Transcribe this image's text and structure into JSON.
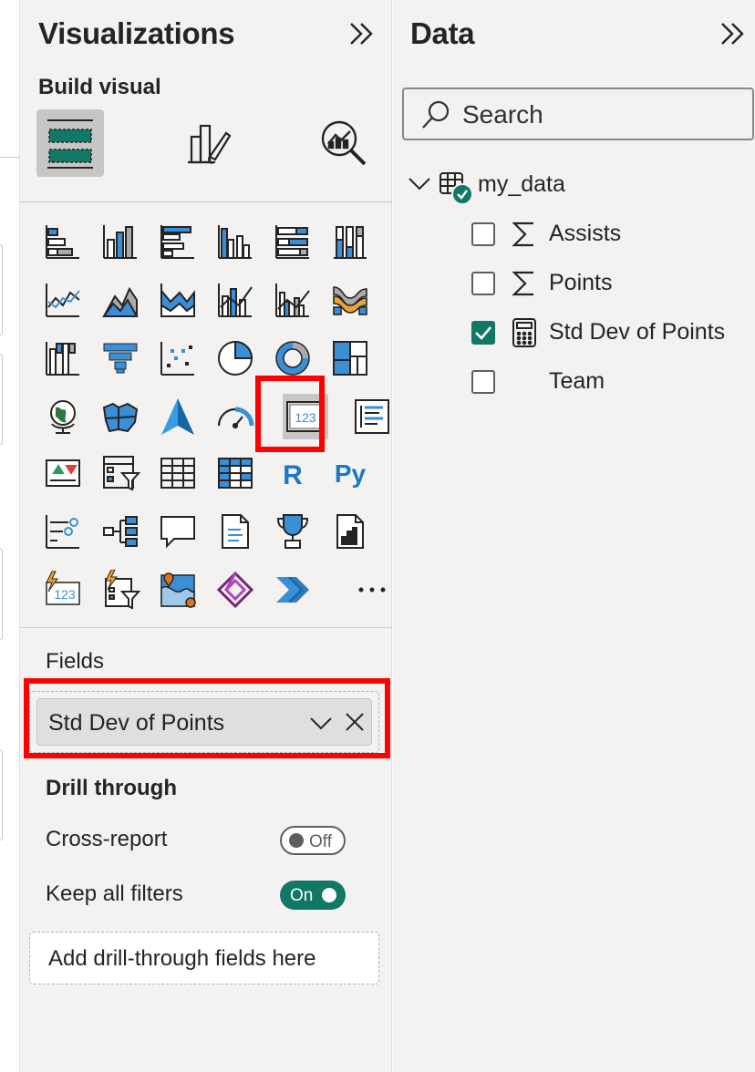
{
  "visualizations": {
    "title": "Visualizations",
    "build_visual_label": "Build visual",
    "tabs": [
      {
        "name": "build-visual-tab",
        "active": true
      },
      {
        "name": "format-visual-tab",
        "active": false
      },
      {
        "name": "analytics-tab",
        "active": false
      }
    ],
    "selected_visual": "card",
    "fields_label": "Fields",
    "field_pill": "Std Dev of Points",
    "drill_through_label": "Drill through",
    "cross_report_label": "Cross-report",
    "cross_report_state": "Off",
    "keep_filters_label": "Keep all filters",
    "keep_filters_state": "On",
    "drop_zone_placeholder": "Add drill-through fields here"
  },
  "data_pane": {
    "title": "Data",
    "search_placeholder": "Search",
    "table_name": "my_data",
    "fields": [
      {
        "label": "Assists",
        "type": "sigma",
        "checked": false
      },
      {
        "label": "Points",
        "type": "sigma",
        "checked": false
      },
      {
        "label": "Std Dev of Points",
        "type": "calculator",
        "checked": true
      },
      {
        "label": "Team",
        "type": "none",
        "checked": false
      }
    ]
  },
  "colors": {
    "accent_teal": "#117865",
    "highlight_red": "#ff0000",
    "visual_blue": "#3a8fd6",
    "pane_bg": "#f3f2f1"
  }
}
